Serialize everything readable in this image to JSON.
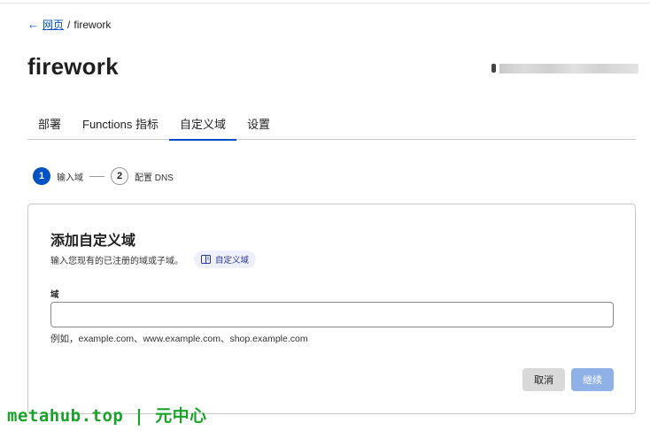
{
  "breadcrumb": {
    "back_arrow": "←",
    "parent": "网页",
    "separator": "/",
    "current": "firework"
  },
  "page": {
    "title": "firework"
  },
  "tabs": [
    {
      "label": "部署",
      "active": false
    },
    {
      "label": "Functions 指标",
      "active": false
    },
    {
      "label": "自定义域",
      "active": true
    },
    {
      "label": "设置",
      "active": false
    }
  ],
  "steps": [
    {
      "number": "1",
      "label": "输入域",
      "state": "active"
    },
    {
      "number": "2",
      "label": "配置 DNS",
      "state": "inactive"
    }
  ],
  "card": {
    "title": "添加自定义域",
    "description": "输入您现有的已注册的域或子域。",
    "doc_chip_label": "自定义域",
    "doc_chip_icon": "book-icon",
    "field_label": "域",
    "input_value": "",
    "hint": "例如，example.com、www.example.com、shop.example.com",
    "cancel_label": "取消",
    "continue_label": "继续"
  },
  "watermark": "metahub.top | 元中心",
  "colors": {
    "accent": "#0051c3",
    "continue_disabled": "#8fb1e6",
    "cancel_bg": "#d9d9d9",
    "watermark": "#1aa329"
  }
}
